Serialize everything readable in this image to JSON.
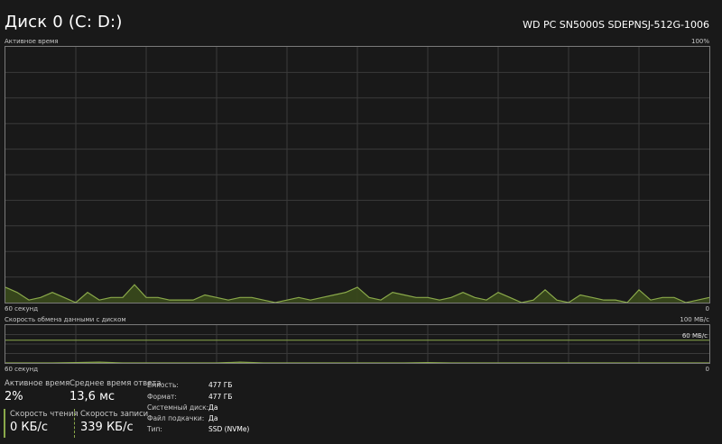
{
  "header": {
    "title": "Диск 0 (C: D:)",
    "model": "WD PC SN5000S SDEPNSJ-512G-1006"
  },
  "active_time_graph": {
    "label": "Активное время",
    "max_label": "100%",
    "time_label": "60 секунд",
    "min_label": "0"
  },
  "transfer_graph": {
    "label": "Скорость обмена данными с диском",
    "max_label": "100 МБ/с",
    "secondary_label": "60 МБ/с",
    "time_label": "60 секунд",
    "min_label": "0"
  },
  "stats": {
    "active_time": {
      "title": "Активное время",
      "value": "2%"
    },
    "response_time": {
      "title": "Среднее время ответа",
      "value": "13,6 мс"
    },
    "read_speed": {
      "title": "Скорость чтения",
      "value": "0 КБ/с"
    },
    "write_speed": {
      "title": "Скорость записи",
      "value": "339 КБ/с"
    }
  },
  "properties": [
    {
      "key": "Емкость:",
      "value": "477 ГБ"
    },
    {
      "key": "Формат:",
      "value": "477 ГБ"
    },
    {
      "key": "Системный диск:",
      "value": "Да"
    },
    {
      "key": "Файл подкачки:",
      "value": "Да"
    },
    {
      "key": "Тип:",
      "value": "SSD (NVMe)"
    }
  ],
  "colors": {
    "background": "#191919",
    "graph_line": "#8aa94a",
    "graph_fill": "#3a4a1c",
    "grid": "#3a3a3a",
    "border": "#7a7a7a"
  },
  "chart_data": [
    {
      "type": "area",
      "ylim": [
        0,
        100
      ],
      "x_seconds_ago": [
        60,
        59,
        58,
        57,
        56,
        55,
        54,
        53,
        52,
        51,
        50,
        49,
        48,
        47,
        46,
        45,
        44,
        43,
        42,
        41,
        40,
        39,
        38,
        37,
        36,
        35,
        34,
        33,
        32,
        31,
        30,
        29,
        28,
        27,
        26,
        25,
        24,
        23,
        22,
        21,
        20,
        19,
        18,
        17,
        16,
        15,
        14,
        13,
        12,
        11,
        10,
        9,
        8,
        7,
        6,
        5,
        4,
        3,
        2,
        1,
        0
      ],
      "values": [
        6,
        4,
        1,
        2,
        4,
        2,
        0,
        4,
        1,
        2,
        2,
        7,
        2,
        2,
        1,
        1,
        1,
        3,
        2,
        1,
        2,
        2,
        1,
        0,
        1,
        2,
        1,
        2,
        3,
        4,
        6,
        2,
        1,
        4,
        3,
        2,
        2,
        1,
        2,
        4,
        2,
        1,
        4,
        2,
        0,
        1,
        5,
        1,
        0,
        3,
        2,
        1,
        1,
        0,
        5,
        1,
        2,
        2,
        0,
        1,
        2
      ]
    },
    {
      "type": "area",
      "ylim": [
        0,
        100
      ],
      "x_seconds_ago": [
        60,
        58,
        56,
        54,
        52,
        50,
        48,
        46,
        44,
        42,
        40,
        38,
        36,
        34,
        32,
        30,
        28,
        26,
        24,
        22,
        20,
        18,
        16,
        14,
        12,
        10,
        8,
        6,
        4,
        2,
        0
      ],
      "values": [
        0,
        0,
        0,
        1,
        2,
        0,
        0,
        0,
        0,
        0,
        2,
        0,
        0,
        0,
        0,
        0,
        0,
        0,
        1,
        0,
        0,
        0,
        0,
        0,
        0,
        0,
        0,
        0,
        0,
        0,
        0
      ]
    }
  ]
}
